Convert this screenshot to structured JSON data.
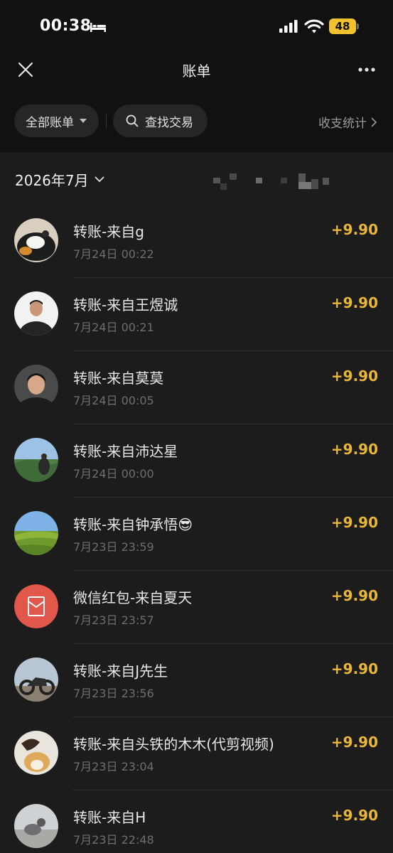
{
  "status_bar": {
    "time": "00:38",
    "battery": "48",
    "icons": [
      "bed-icon",
      "signal-icon",
      "wifi-icon",
      "battery-icon"
    ]
  },
  "header": {
    "title": "账单",
    "left_icon": "close-icon",
    "right_icon": "more-icon"
  },
  "filters": {
    "all_bills": "全部账单",
    "search": "查找交易",
    "stats": "收支统计"
  },
  "month": "2026年7月",
  "colors": {
    "background": "#111111",
    "panel": "#1c1c1c",
    "amount": "#e8b63a",
    "battery": "#f2c12e",
    "red_packet": "#e2574c"
  },
  "transactions": [
    {
      "title": "转账-来自g",
      "time": "7月24日 00:22",
      "amount": "+9.90",
      "avatar": "dog-avatar"
    },
    {
      "title": "转账-来自王煜诚",
      "time": "7月24日 00:21",
      "amount": "+9.90",
      "avatar": "person-avatar"
    },
    {
      "title": "转账-来自莫莫",
      "time": "7月24日 00:05",
      "amount": "+9.90",
      "avatar": "person-avatar"
    },
    {
      "title": "转账-来自沛达星",
      "time": "7月24日 00:00",
      "amount": "+9.90",
      "avatar": "landscape-avatar"
    },
    {
      "title": "转账-来自钟承悟😎",
      "time": "7月23日 23:59",
      "amount": "+9.90",
      "avatar": "field-avatar"
    },
    {
      "title": "微信红包-来自夏天",
      "time": "7月23日 23:57",
      "amount": "+9.90",
      "avatar": "red-packet-icon"
    },
    {
      "title": "转账-来自J先生",
      "time": "7月23日 23:56",
      "amount": "+9.90",
      "avatar": "motorcycle-avatar"
    },
    {
      "title": "转账-来自头铁的木木(代剪视频)",
      "time": "7月23日 23:04",
      "amount": "+9.90",
      "avatar": "dog-avatar"
    },
    {
      "title": "转账-来自H",
      "time": "7月23日 22:48",
      "amount": "+9.90",
      "avatar": "room-avatar"
    }
  ]
}
